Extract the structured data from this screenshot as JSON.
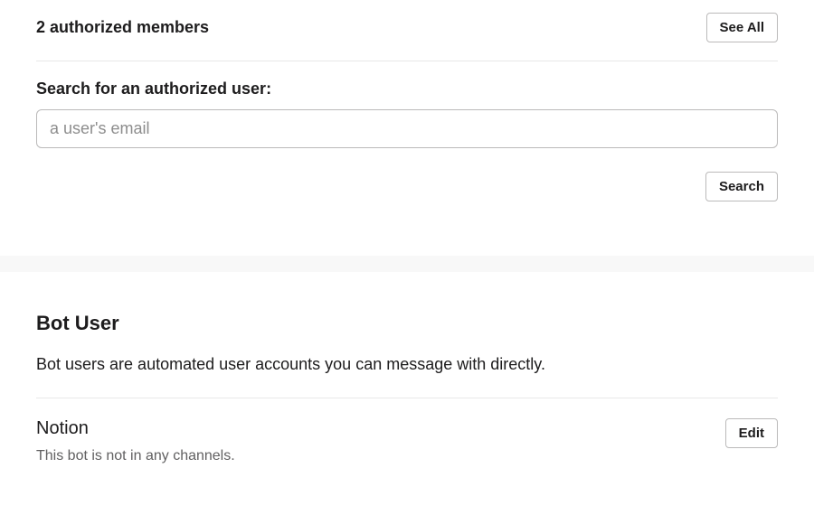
{
  "members": {
    "title": "2 authorized members",
    "see_all_label": "See All"
  },
  "search": {
    "label": "Search for an authorized user:",
    "placeholder": "a user's email",
    "button_label": "Search"
  },
  "bot_section": {
    "title": "Bot User",
    "description": "Bot users are automated user accounts you can message with directly.",
    "item": {
      "name": "Notion",
      "status": "This bot is not in any channels.",
      "edit_label": "Edit"
    }
  }
}
